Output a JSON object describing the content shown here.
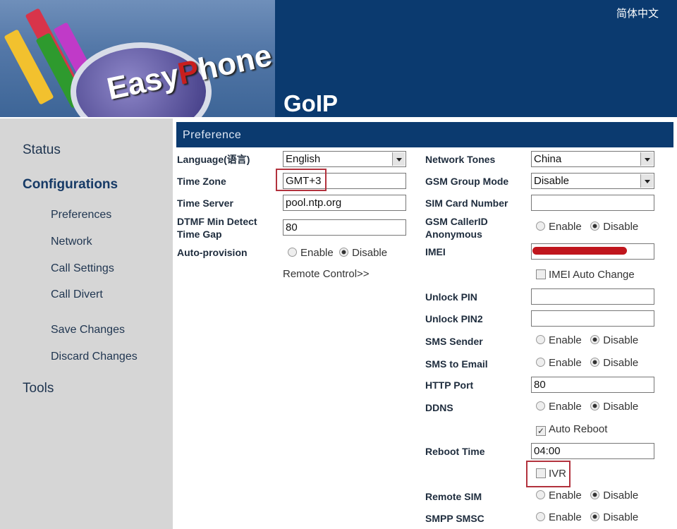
{
  "header": {
    "logo_text": "EasyPhone",
    "product": "GoIP",
    "language_link": "简体中文"
  },
  "sidebar": {
    "status": "Status",
    "configurations": "Configurations",
    "preferences": "Preferences",
    "network": "Network",
    "call_settings": "Call Settings",
    "call_divert": "Call Divert",
    "save_changes": "Save Changes",
    "discard_changes": "Discard Changes",
    "tools": "Tools"
  },
  "panel": {
    "title": "Preference"
  },
  "left": {
    "language": {
      "label": "Language(语言)",
      "value": "English"
    },
    "time_zone": {
      "label": "Time Zone",
      "value": "GMT+3"
    },
    "time_server": {
      "label": "Time Server",
      "value": "pool.ntp.org"
    },
    "dtmf": {
      "label": "DTMF Min Detect Time Gap",
      "value": "80"
    },
    "auto_provision": {
      "label": "Auto-provision",
      "enable": "Enable",
      "disable": "Disable",
      "selected": "Disable"
    },
    "remote_control": "Remote Control>>"
  },
  "right": {
    "network_tones": {
      "label": "Network Tones",
      "value": "China"
    },
    "gsm_group_mode": {
      "label": "GSM Group Mode",
      "value": "Disable"
    },
    "sim_card_number": {
      "label": "SIM Card Number",
      "value": ""
    },
    "gsm_callerid": {
      "label": "GSM CallerID Anonymous",
      "selected": "Disable"
    },
    "imei": {
      "label": "IMEI",
      "value": "(redacted)"
    },
    "imei_auto_change": {
      "label": "IMEI Auto Change",
      "checked": false
    },
    "unlock_pin": {
      "label": "Unlock PIN",
      "value": ""
    },
    "unlock_pin2": {
      "label": "Unlock PIN2",
      "value": ""
    },
    "sms_sender": {
      "label": "SMS Sender",
      "selected": "Disable"
    },
    "sms_to_email": {
      "label": "SMS to Email",
      "selected": "Disable"
    },
    "http_port": {
      "label": "HTTP Port",
      "value": "80"
    },
    "ddns": {
      "label": "DDNS",
      "selected": "Disable"
    },
    "auto_reboot": {
      "label": "Auto Reboot",
      "checked": true
    },
    "reboot_time": {
      "label": "Reboot Time",
      "value": "04:00"
    },
    "ivr": {
      "label": "IVR",
      "checked": false
    },
    "remote_sim": {
      "label": "Remote SIM",
      "selected": "Disable"
    },
    "smpp_smsc": {
      "label": "SMPP SMSC",
      "selected": "Disable"
    },
    "enable": "Enable",
    "disable": "Disable"
  },
  "colors": {
    "header": "#0b3a6f",
    "sidebar": "#d6d6d6",
    "highlight": "#b2323d"
  }
}
